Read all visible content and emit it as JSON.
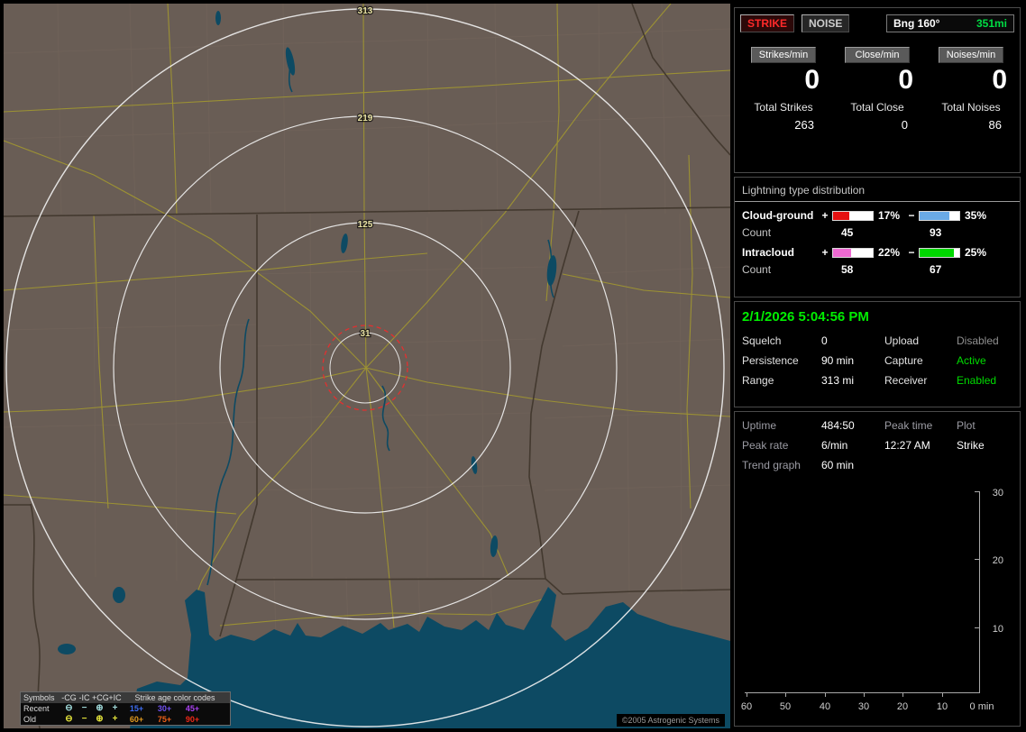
{
  "map": {
    "rings": [
      "313",
      "219",
      "125",
      "31"
    ],
    "copyright": "©2005 Astrogenic Systems",
    "legend": {
      "symbols": "Symbols",
      "cols": [
        "-CG",
        "-IC",
        "+CG",
        "+IC"
      ],
      "age_title": "Strike age color codes",
      "recent_label": "Recent",
      "old_label": "Old",
      "icons": {
        "cg_minus": "⊖",
        "ic_minus": "−",
        "cg_plus": "⊕",
        "ic_plus": "+"
      },
      "recent_icon_color": "#9fd8d8",
      "old_icon_color": "#e2e23a",
      "recent_ages": [
        {
          "t": "15+",
          "c": "#3c6cf0"
        },
        {
          "t": "30+",
          "c": "#7050f0"
        },
        {
          "t": "45+",
          "c": "#a840f0"
        }
      ],
      "old_ages": [
        {
          "t": "60+",
          "c": "#e09a20"
        },
        {
          "t": "75+",
          "c": "#ee6018"
        },
        {
          "t": "90+",
          "c": "#ee2818"
        }
      ]
    }
  },
  "topbar": {
    "strike": "STRIKE",
    "strike_color": "#ff2a2a",
    "noise": "NOISE",
    "noise_color": "#cccccc",
    "bearing_label": "Bng 160°",
    "bearing_value": "351mi",
    "bearing_color": "#00dd44"
  },
  "stats": {
    "columns": [
      {
        "header": "Strikes/min",
        "rate": "0",
        "total_label": "Total Strikes",
        "total": "263"
      },
      {
        "header": "Close/min",
        "rate": "0",
        "total_label": "Total Close",
        "total": "0"
      },
      {
        "header": "Noises/min",
        "rate": "0",
        "total_label": "Total Noises",
        "total": "86"
      }
    ]
  },
  "distribution": {
    "title": "Lightning type distribution",
    "plus_sign": "+",
    "minus_sign": "−",
    "count_label": "Count",
    "rows": [
      {
        "name": "Cloud-ground",
        "plus_pct": "17%",
        "minus_pct": "35%",
        "plus_color": "#e51010",
        "minus_color": "#6aaae6",
        "plus_fill": 40,
        "minus_fill": 76,
        "plus_count": "45",
        "minus_count": "93"
      },
      {
        "name": "Intracloud",
        "plus_pct": "22%",
        "minus_pct": "25%",
        "plus_color": "#ee6ad2",
        "minus_color": "#00d800",
        "plus_fill": 46,
        "minus_fill": 86,
        "plus_count": "58",
        "minus_count": "67"
      }
    ]
  },
  "status": {
    "datetime": "2/1/2026 5:04:56 PM",
    "datetime_color": "#00ee00",
    "rows": [
      {
        "l1": "Squelch",
        "v1": "0",
        "l2": "Upload",
        "v2": "Disabled",
        "v2_color": "#909090"
      },
      {
        "l1": "Persistence",
        "v1": "90 min",
        "l2": "Capture",
        "v2": "Active",
        "v2_color": "#00dd00"
      },
      {
        "l1": "Range",
        "v1": "313 mi",
        "l2": "Receiver",
        "v2": "Enabled",
        "v2_color": "#00dd00"
      }
    ]
  },
  "session": {
    "uptime_label": "Uptime",
    "uptime": "484:50",
    "peak_time_label": "Peak time",
    "plot_label": "Plot",
    "peak_rate_label": "Peak rate",
    "peak_rate": "6/min",
    "peak_time": "12:27 AM",
    "plot": "Strike",
    "trend_label": "Trend graph",
    "trend_value": "60 min"
  },
  "trend": {
    "y_ticks": [
      "30",
      "20",
      "10"
    ],
    "x_ticks": [
      "60",
      "50",
      "40",
      "30",
      "20",
      "10"
    ],
    "x_zero": "0 min"
  }
}
